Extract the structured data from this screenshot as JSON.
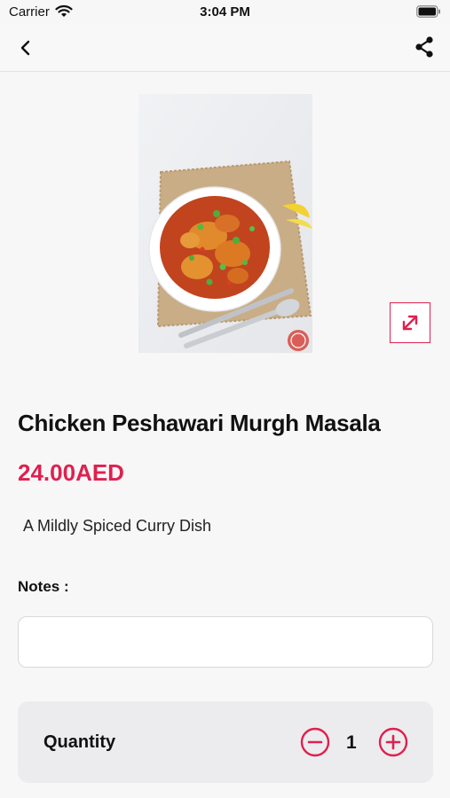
{
  "status_bar": {
    "carrier": "Carrier",
    "time": "3:04 PM"
  },
  "nav": {
    "back_icon": "chevron-left-icon",
    "share_icon": "share-icon"
  },
  "product": {
    "title": "Chicken Peshawari Murgh Masala",
    "price": "24.00AED",
    "description": "A Mildly Spiced Curry Dish",
    "expand_icon": "expand-arrows-icon"
  },
  "notes": {
    "label": "Notes :",
    "value": "",
    "placeholder": ""
  },
  "quantity": {
    "label": "Quantity",
    "value": "1"
  },
  "colors": {
    "accent": "#e0204e",
    "background": "#f7f7f8",
    "card": "#ececef"
  }
}
